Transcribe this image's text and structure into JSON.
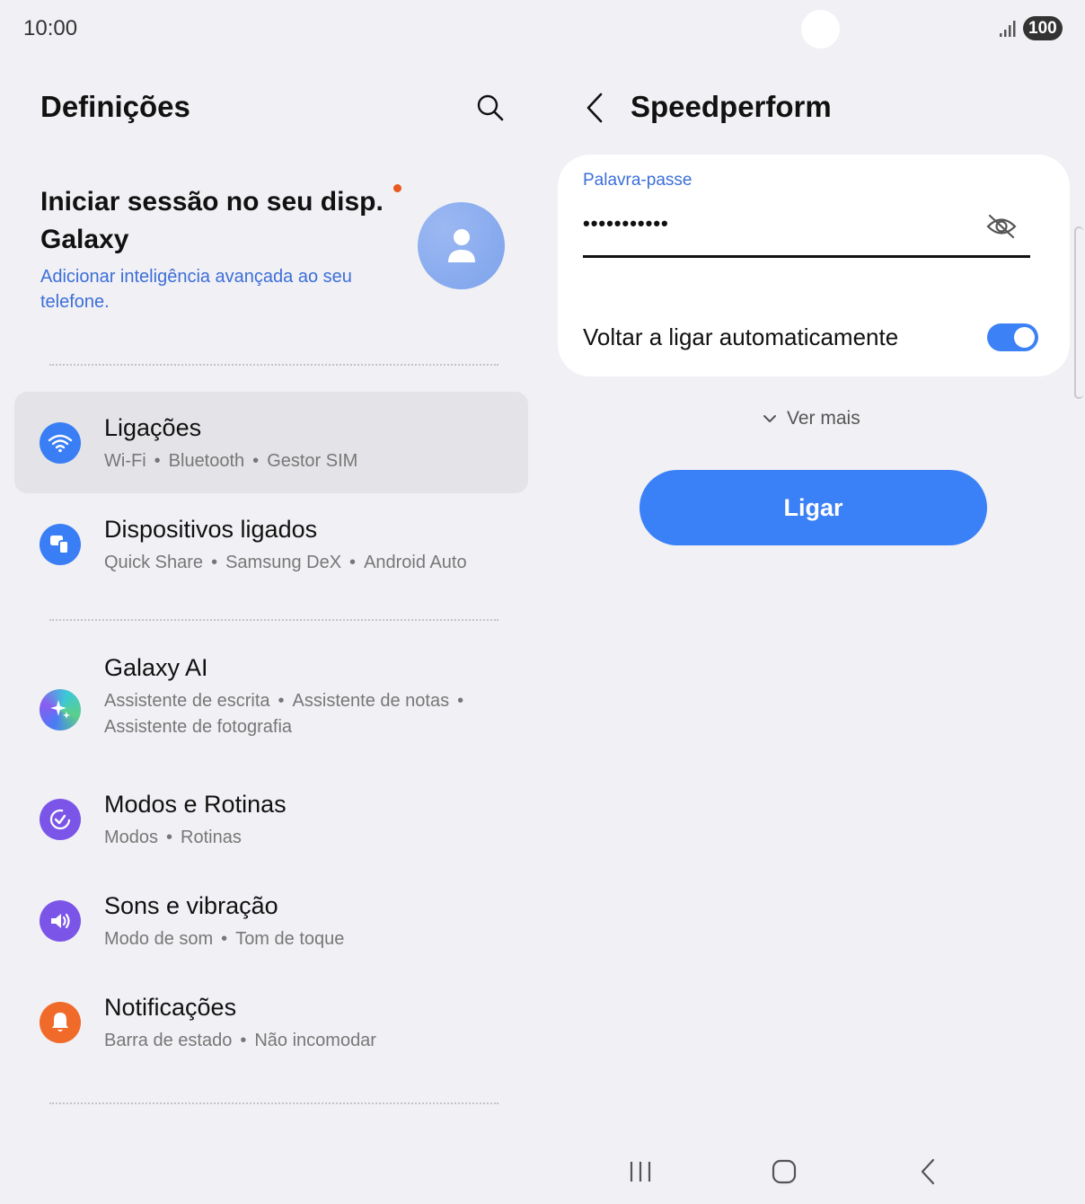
{
  "status": {
    "time": "10:00",
    "battery": "100"
  },
  "left": {
    "title": "Definições",
    "account": {
      "title": "Iniciar sessão no seu disp. Galaxy",
      "subtitle": "Adicionar inteligência avançada ao seu telefone."
    },
    "items": [
      {
        "title": "Ligações",
        "subs": [
          "Wi-Fi",
          "Bluetooth",
          "Gestor SIM"
        ],
        "icon": "wifi-icon",
        "color": "#3a7ef5"
      },
      {
        "title": "Dispositivos ligados",
        "subs": [
          "Quick Share",
          "Samsung DeX",
          "Android Auto"
        ],
        "icon": "connected-devices-icon",
        "color": "#3a7ef5"
      },
      {
        "title": "Galaxy AI",
        "subs": [
          "Assistente de escrita",
          "Assistente de notas",
          "Assistente de fotografia"
        ],
        "icon": "galaxy-ai-icon",
        "color": "#5b6cf0"
      },
      {
        "title": "Modos e Rotinas",
        "subs": [
          "Modos",
          "Rotinas"
        ],
        "icon": "modes-routines-icon",
        "color": "#7b55e8"
      },
      {
        "title": "Sons e vibração",
        "subs": [
          "Modo de som",
          "Tom de toque"
        ],
        "icon": "volume-icon",
        "color": "#7b55e8"
      },
      {
        "title": "Notificações",
        "subs": [
          "Barra de estado",
          "Não incomodar"
        ],
        "icon": "bell-icon",
        "color": "#f06a2a"
      }
    ]
  },
  "right": {
    "title": "Speedperform",
    "password_label": "Palavra-passe",
    "password_value": "•••••••••••",
    "auto_reconnect_label": "Voltar a ligar automaticamente",
    "auto_reconnect": true,
    "see_more": "Ver mais",
    "connect_button": "Ligar"
  },
  "colors": {
    "accent": "#3a80f6",
    "background": "#f1f0f4",
    "link": "#3c6fd8"
  }
}
